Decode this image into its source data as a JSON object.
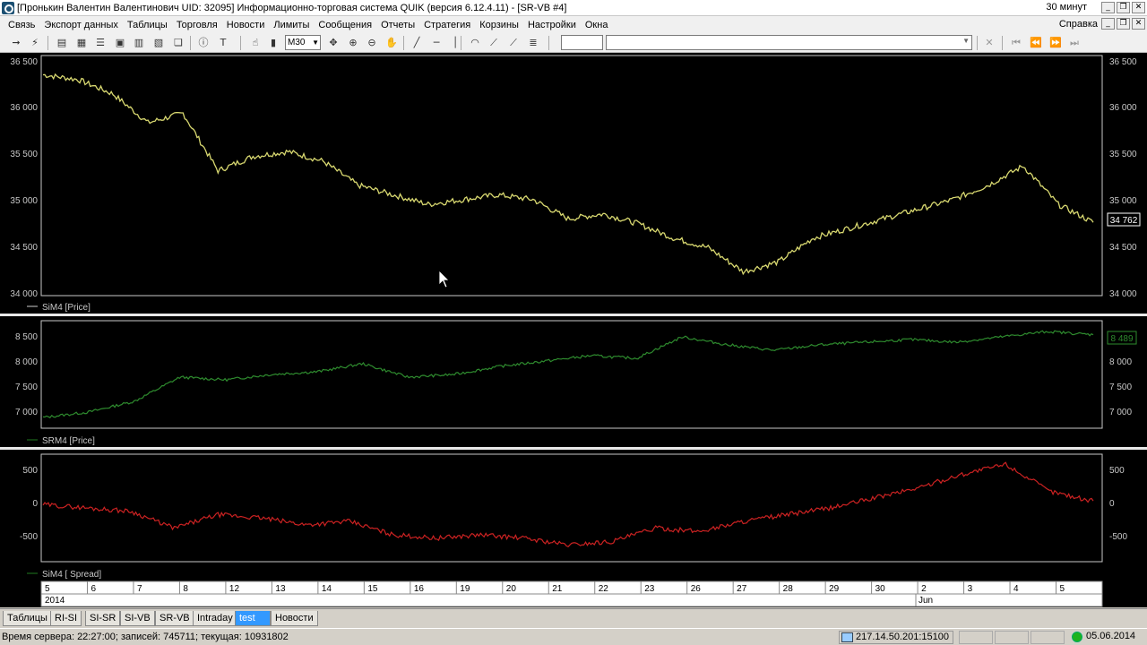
{
  "window": {
    "title": "[Пронькин Валентин Валентинович UID: 32095] Информационно-торговая система QUIK (версия 6.12.4.11) - [SR-VB #4]",
    "timeframe_label": "30 минут",
    "help_menu": "Справка"
  },
  "menu": [
    "Связь",
    "Экспорт данных",
    "Таблицы",
    "Торговля",
    "Новости",
    "Лимиты",
    "Сообщения",
    "Отчеты",
    "Стратегия",
    "Корзины",
    "Настройки",
    "Окна"
  ],
  "toolbar": {
    "interval": "M30"
  },
  "panes": [
    {
      "legend": "SiM4 [Price]",
      "y_ticks": [
        "36 500",
        "36 000",
        "35 500",
        "35 000",
        "34 500",
        "34 000"
      ],
      "last_value": "34 762",
      "colors": {
        "series": "#d8d870",
        "legend_line": "#cccccc",
        "last_box": "#ffffff"
      }
    },
    {
      "legend": "SRM4 [Price]",
      "y_ticks": [
        "8 500",
        "8 000",
        "7 500",
        "7 000"
      ],
      "last_value": "8 489",
      "colors": {
        "series": "#2e8b2e",
        "legend_line": "#1f7a1f",
        "last_box": "#2e8b2e"
      }
    },
    {
      "legend": "SiM4 [ Spread]",
      "y_ticks": [
        "500",
        "0",
        "-500"
      ],
      "colors": {
        "series": "#cc2222",
        "legend_line": "#1f7a1f"
      }
    }
  ],
  "chart_data": [
    {
      "type": "line",
      "name": "SiM4 [Price]",
      "ylim": [
        34000,
        36500
      ],
      "x_categories": [
        "5",
        "6",
        "7",
        "8",
        "12",
        "13",
        "14",
        "15",
        "16",
        "19",
        "20",
        "21",
        "22",
        "23",
        "26",
        "27",
        "28",
        "29",
        "30",
        "2",
        "3",
        "4",
        "5"
      ],
      "y_anchors": [
        36300,
        36250,
        36100,
        35800,
        35900,
        35300,
        35450,
        35500,
        35400,
        35150,
        35050,
        34950,
        35000,
        35050,
        35000,
        34800,
        34850,
        34750,
        34600,
        34500,
        34250,
        34350,
        34600,
        34700,
        34800,
        34900,
        35000,
        35150,
        35350,
        34950,
        34762
      ],
      "last": 34762
    },
    {
      "type": "line",
      "name": "SRM4 [Price]",
      "ylim": [
        6750,
        8750
      ],
      "x_categories": [
        "5",
        "6",
        "7",
        "8",
        "12",
        "13",
        "14",
        "15",
        "16",
        "19",
        "20",
        "21",
        "22",
        "23",
        "26",
        "27",
        "28",
        "29",
        "30",
        "2",
        "3",
        "4",
        "5"
      ],
      "y_anchors": [
        6950,
        7050,
        7250,
        7700,
        7650,
        7750,
        7800,
        7950,
        7700,
        7750,
        7900,
        8000,
        8100,
        8050,
        8450,
        8300,
        8200,
        8300,
        8350,
        8400,
        8350,
        8450,
        8550,
        8489
      ],
      "last": 8489
    },
    {
      "type": "line",
      "name": "SiM4 [ Spread]",
      "ylim": [
        -900,
        700
      ],
      "x_categories": [
        "5",
        "6",
        "7",
        "8",
        "12",
        "13",
        "14",
        "15",
        "16",
        "19",
        "20",
        "21",
        "22",
        "23",
        "26",
        "27",
        "28",
        "29",
        "30",
        "2",
        "3",
        "4",
        "5"
      ],
      "y_anchors": [
        -50,
        -100,
        -150,
        -400,
        -200,
        -250,
        -350,
        -300,
        -500,
        -550,
        -500,
        -550,
        -650,
        -600,
        -400,
        -450,
        -300,
        -200,
        -100,
        50,
        200,
        400,
        550,
        150,
        0
      ]
    }
  ],
  "time_axis": {
    "labels": [
      "5",
      "6",
      "7",
      "8",
      "12",
      "13",
      "14",
      "15",
      "16",
      "19",
      "20",
      "21",
      "22",
      "23",
      "26",
      "27",
      "28",
      "29",
      "30",
      "2",
      "3",
      "4",
      "5"
    ],
    "sub_labels": [
      "2014",
      "Jun"
    ]
  },
  "tabs": [
    "Таблицы",
    "RI-SI",
    "SI-SR",
    "SI-VB",
    "SR-VB",
    "Intraday",
    "test",
    "Новости"
  ],
  "active_tab": "test",
  "status": {
    "left": "Время сервера: 22:27:00; записей: 745711; текущая: 10931802",
    "ip": "217.14.50.201:15100",
    "date": "05.06.2014"
  }
}
